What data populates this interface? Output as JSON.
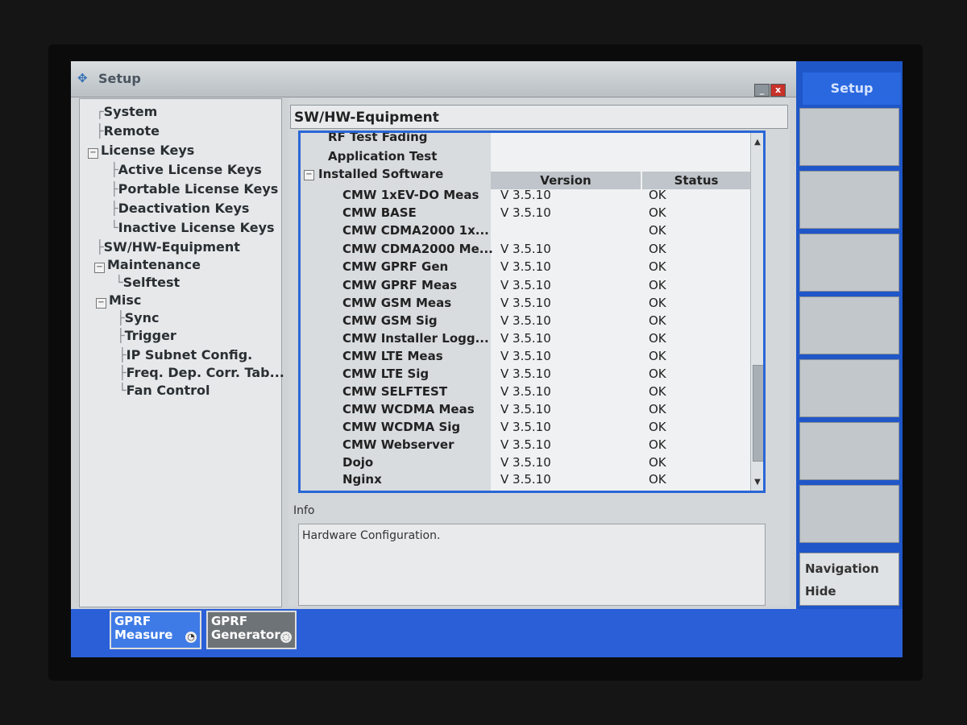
{
  "window": {
    "title": "Setup",
    "minimize_symbol": "_",
    "close_symbol": "x"
  },
  "tree": [
    {
      "label": "System"
    },
    {
      "label": "Remote"
    },
    {
      "label": "License Keys"
    },
    {
      "label": "Active License Keys"
    },
    {
      "label": "Portable License Keys"
    },
    {
      "label": "Deactivation Keys"
    },
    {
      "label": "Inactive License Keys"
    },
    {
      "label": "SW/HW-Equipment"
    },
    {
      "label": "Maintenance"
    },
    {
      "label": "Selftest"
    },
    {
      "label": "Misc"
    },
    {
      "label": "Sync"
    },
    {
      "label": "Trigger"
    },
    {
      "label": "IP Subnet Config."
    },
    {
      "label": "Freq. Dep. Corr. Tab..."
    },
    {
      "label": "Fan Control"
    }
  ],
  "content": {
    "header": "SW/HW-Equipment",
    "groups": {
      "rf_test_fading": "RF Test Fading",
      "application_test": "Application Test",
      "installed_software": "Installed Software"
    },
    "columns": {
      "version": "Version",
      "status": "Status"
    },
    "software": [
      {
        "name": "CMW 1xEV-DO Meas",
        "version": "V 3.5.10",
        "status": "OK"
      },
      {
        "name": "CMW BASE",
        "version": "V 3.5.10",
        "status": "OK"
      },
      {
        "name": "CMW CDMA2000 1x...",
        "version": "",
        "status": "OK"
      },
      {
        "name": "CMW CDMA2000 Me...",
        "version": "V 3.5.10",
        "status": "OK"
      },
      {
        "name": "CMW GPRF Gen",
        "version": "V 3.5.10",
        "status": "OK"
      },
      {
        "name": "CMW GPRF Meas",
        "version": "V 3.5.10",
        "status": "OK"
      },
      {
        "name": "CMW GSM Meas",
        "version": "V 3.5.10",
        "status": "OK"
      },
      {
        "name": "CMW GSM Sig",
        "version": "V 3.5.10",
        "status": "OK"
      },
      {
        "name": "CMW Installer Logg...",
        "version": "V 3.5.10",
        "status": "OK"
      },
      {
        "name": "CMW LTE Meas",
        "version": "V 3.5.10",
        "status": "OK"
      },
      {
        "name": "CMW LTE Sig",
        "version": "V 3.5.10",
        "status": "OK"
      },
      {
        "name": "CMW SELFTEST",
        "version": "V 3.5.10",
        "status": "OK"
      },
      {
        "name": "CMW WCDMA Meas",
        "version": "V 3.5.10",
        "status": "OK"
      },
      {
        "name": "CMW WCDMA Sig",
        "version": "V 3.5.10",
        "status": "OK"
      },
      {
        "name": "CMW Webserver",
        "version": "V 3.5.10",
        "status": "OK"
      },
      {
        "name": "Dojo",
        "version": "V 3.5.10",
        "status": "OK"
      },
      {
        "name": "Nginx",
        "version": "V 3.5.10",
        "status": "OK"
      }
    ],
    "info_label": "Info",
    "info_text": "Hardware Configuration."
  },
  "softkeys": {
    "title": "Setup",
    "navigation": "Navigation",
    "hide": "Hide"
  },
  "bottom_tabs": [
    {
      "line1": "GPRF",
      "line2": "Measure"
    },
    {
      "line1": "GPRF",
      "line2": "Generator"
    }
  ],
  "colors": {
    "accent_blue": "#2a66d6",
    "softkey_bar": "#1f56c8",
    "close_red": "#c8322a"
  }
}
